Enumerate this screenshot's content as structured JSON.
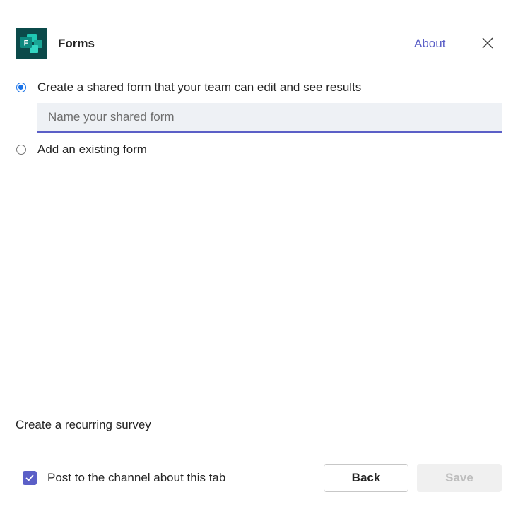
{
  "header": {
    "app_title": "Forms",
    "app_icon_letter": "F",
    "about_label": "About",
    "close_icon": "close-icon"
  },
  "options": [
    {
      "label": "Create a shared form that your team can edit and see results",
      "selected": true
    },
    {
      "label": "Add an existing form",
      "selected": false
    }
  ],
  "name_input": {
    "value": "",
    "placeholder": "Name your shared form"
  },
  "recurring_survey_label": "Create a recurring survey",
  "footer": {
    "post_to_channel_label": "Post to the channel about this tab",
    "post_to_channel_checked": true,
    "back_label": "Back",
    "save_label": "Save",
    "save_enabled": false
  },
  "colors": {
    "accent": "#5b5fc7",
    "radio_selected": "#1a73e8",
    "forms_icon_bg": "#0b4a4a",
    "forms_icon_tile": "#1bb6a8"
  }
}
